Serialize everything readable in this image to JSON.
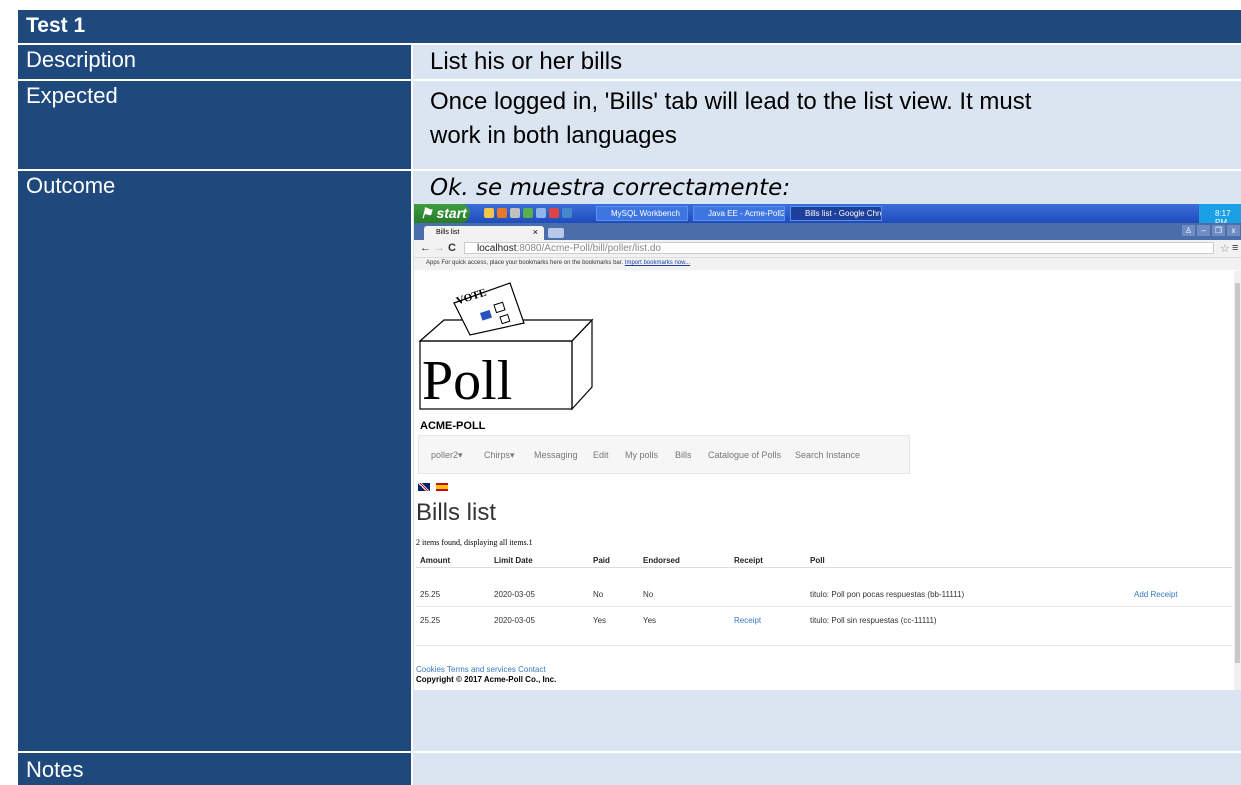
{
  "test_title": "Test 1",
  "rows": {
    "description": {
      "label": "Description",
      "value": "List his or her bills"
    },
    "expected": {
      "label": "Expected",
      "value_line1": "Once logged in, 'Bills' tab will lead to the list view. It must",
      "value_line2": "work in both languages"
    },
    "outcome": {
      "label": "Outcome",
      "value": "Ok. se muestra correctamente:"
    },
    "notes": {
      "label": "Notes"
    }
  },
  "colors": {
    "header_blue": "#1f497d",
    "cell_light_blue": "#dbe5f1"
  },
  "screenshot": {
    "taskbar": {
      "start_label": "start",
      "tasks": [
        "MySQL Workbench",
        "Java EE - Acme-Poll2....",
        "Bills list - Google Chrome"
      ],
      "clock": "8:17 PM"
    },
    "browser": {
      "tab_title": "Bills list",
      "tab_close": "×",
      "url_host": "localhost",
      "url_path": ":8080/Acme-Poll/bill/poller/list.do",
      "bookmarks_text": "Apps   For quick access, place your bookmarks here on the bookmarks bar.",
      "bookmarks_link": "Import bookmarks now..."
    },
    "site": {
      "logo_text": "Poll",
      "logo_vote": "VOTE",
      "brand": "ACME-POLL",
      "menu": [
        "poller2▾",
        "Chirps▾",
        "Messaging",
        "Edit",
        "My polls",
        "Bills",
        "Catalogue of Polls",
        "Search Instance"
      ],
      "page_title": "Bills list",
      "found_text": "2 items found, displaying all items.1",
      "table": {
        "headers": [
          "Amount",
          "Limit Date",
          "Paid",
          "Endorsed",
          "Receipt",
          "Poll"
        ],
        "rows": [
          {
            "amount": "25.25",
            "limit_date": "2020-03-05",
            "paid": "No",
            "endorsed": "No",
            "receipt": "",
            "poll": "titulo: Poll pon pocas respuestas (bb-11111)",
            "action": "Add Receipt"
          },
          {
            "amount": "25.25",
            "limit_date": "2020-03-05",
            "paid": "Yes",
            "endorsed": "Yes",
            "receipt": "Receipt",
            "poll": "titulo: Poll sin respuestas (cc-11111)",
            "action": ""
          }
        ]
      },
      "footer_links": "Cookies Terms and services Contact",
      "copyright": "Copyright © 2017 Acme-Poll Co., Inc."
    }
  }
}
